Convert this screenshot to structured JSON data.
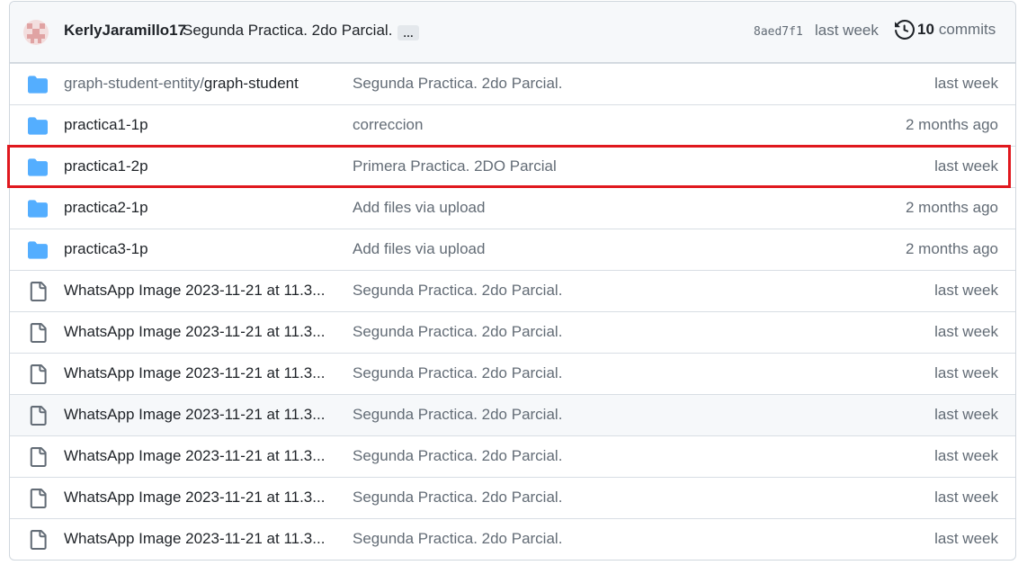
{
  "latest_commit": {
    "author": "KerlyJaramillo17",
    "message": "Segunda Practica. 2do Parcial.",
    "ellipsis": "…",
    "sha": "8aed7f1",
    "age": "last week",
    "commits_count": "10",
    "commits_label": "commits",
    "history_icon": "history-icon"
  },
  "files": [
    {
      "type": "folder",
      "name_prefix": "graph-student-entity/",
      "name": "graph-student",
      "message": "Segunda Practica. 2do Parcial.",
      "age": "last week"
    },
    {
      "type": "folder",
      "name_prefix": "",
      "name": "practica1-1p",
      "message": "correccion",
      "age": "2 months ago"
    },
    {
      "type": "folder",
      "name_prefix": "",
      "name": "practica1-2p",
      "message": "Primera Practica. 2DO Parcial",
      "age": "last week"
    },
    {
      "type": "folder",
      "name_prefix": "",
      "name": "practica2-1p",
      "message": "Add files via upload",
      "age": "2 months ago"
    },
    {
      "type": "folder",
      "name_prefix": "",
      "name": "practica3-1p",
      "message": "Add files via upload",
      "age": "2 months ago"
    },
    {
      "type": "file",
      "name_prefix": "",
      "name": "WhatsApp Image 2023-11-21 at 11.3...",
      "message": "Segunda Practica. 2do Parcial.",
      "age": "last week"
    },
    {
      "type": "file",
      "name_prefix": "",
      "name": "WhatsApp Image 2023-11-21 at 11.3...",
      "message": "Segunda Practica. 2do Parcial.",
      "age": "last week"
    },
    {
      "type": "file",
      "name_prefix": "",
      "name": "WhatsApp Image 2023-11-21 at 11.3...",
      "message": "Segunda Practica. 2do Parcial.",
      "age": "last week"
    },
    {
      "type": "file",
      "name_prefix": "",
      "name": "WhatsApp Image 2023-11-21 at 11.3...",
      "message": "Segunda Practica. 2do Parcial.",
      "age": "last week"
    },
    {
      "type": "file",
      "name_prefix": "",
      "name": "WhatsApp Image 2023-11-21 at 11.3...",
      "message": "Segunda Practica. 2do Parcial.",
      "age": "last week"
    },
    {
      "type": "file",
      "name_prefix": "",
      "name": "WhatsApp Image 2023-11-21 at 11.3...",
      "message": "Segunda Practica. 2do Parcial.",
      "age": "last week"
    },
    {
      "type": "file",
      "name_prefix": "",
      "name": "WhatsApp Image 2023-11-21 at 11.3...",
      "message": "Segunda Practica. 2do Parcial.",
      "age": "last week"
    }
  ],
  "colors": {
    "folder": "#54aeff",
    "file_icon": "#636c76",
    "highlight": "#e0181e",
    "border": "#d0d7de"
  }
}
